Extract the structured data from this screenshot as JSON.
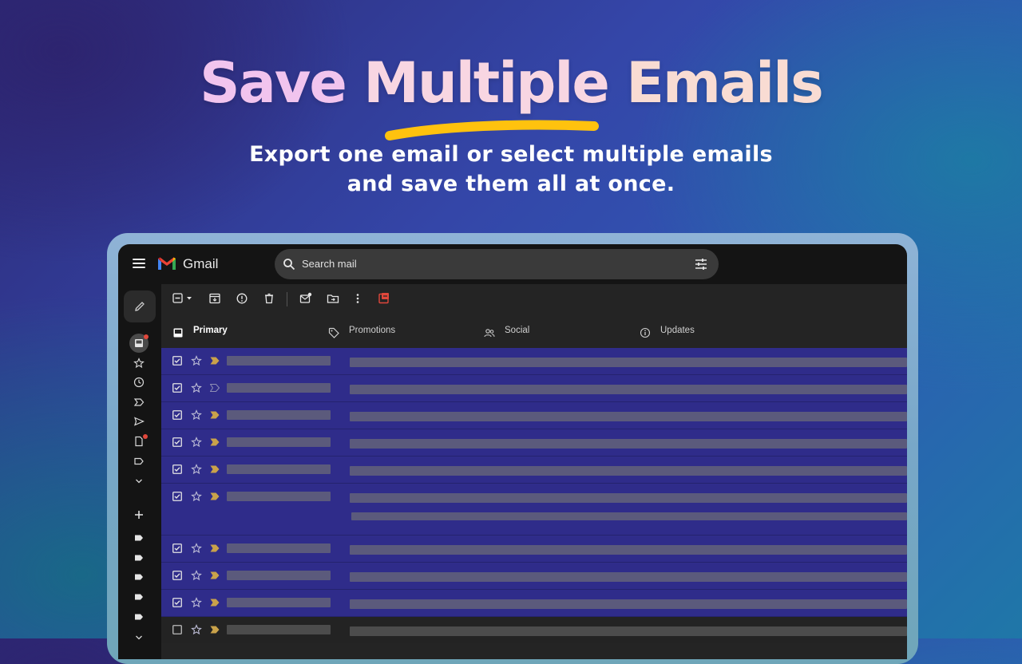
{
  "hero": {
    "title_word1": "Save",
    "title_word2": "Multiple",
    "title_word3": "Emails",
    "subtitle_line1": "Export one email or select multiple emails",
    "subtitle_line2": "and save them all at once."
  },
  "gmail": {
    "app_name": "Gmail",
    "search_placeholder": "Search mail",
    "tabs": [
      {
        "label": "Primary",
        "icon": "inbox-icon",
        "active": true
      },
      {
        "label": "Promotions",
        "icon": "tag-icon",
        "active": false
      },
      {
        "label": "Social",
        "icon": "people-icon",
        "active": false
      },
      {
        "label": "Updates",
        "icon": "info-icon",
        "active": false
      }
    ],
    "colors": {
      "selected_row": "#2f2c8a",
      "importance_marker": "#c9a24a",
      "highlight_swash": "#ffc20e",
      "export_icon": "#e0473b"
    }
  }
}
